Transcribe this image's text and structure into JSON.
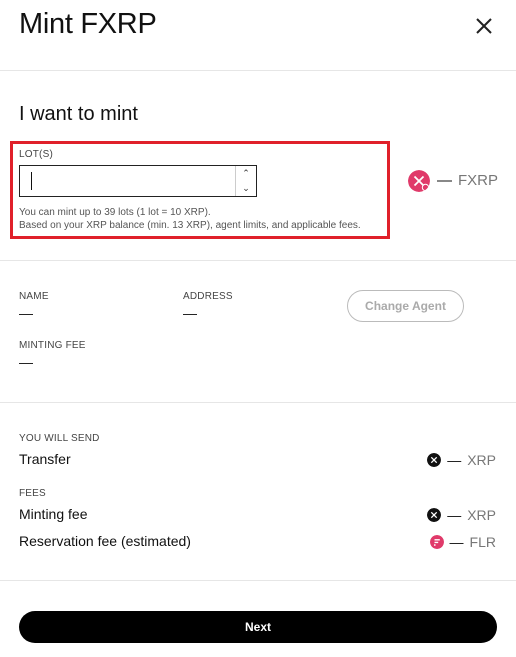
{
  "dialog": {
    "title": "Mint FXRP"
  },
  "mint": {
    "section_title": "I want to mint",
    "lots_label": "LOT(S)",
    "lots_value": "",
    "hint_line1": "You can mint up to 39 lots (1 lot = 10 XRP).",
    "hint_line2": "Based on your XRP balance (min. 13 XRP), agent limits, and applicable fees.",
    "output_amount": "—",
    "output_currency": "FXRP",
    "output_icon": "fxrp-coin-icon"
  },
  "agent": {
    "name_label": "NAME",
    "name_value": "—",
    "address_label": "ADDRESS",
    "address_value": "—",
    "minting_fee_label": "MINTING FEE",
    "minting_fee_value": "—",
    "change_agent_label": "Change Agent"
  },
  "summary": {
    "send_label": "YOU WILL SEND",
    "transfer_label": "Transfer",
    "transfer_amount": "—",
    "transfer_currency": "XRP",
    "fees_label": "FEES",
    "minting_fee_label": "Minting fee",
    "minting_fee_amount": "—",
    "minting_fee_currency": "XRP",
    "reservation_fee_label": "Reservation fee (estimated)",
    "reservation_fee_amount": "—",
    "reservation_fee_currency": "FLR"
  },
  "actions": {
    "next_label": "Next"
  },
  "colors": {
    "highlight": "#e0202a",
    "fxrp": "#e03a6a",
    "flr": "#e03a6a",
    "xrp": "#111111",
    "primary_button": "#000000"
  }
}
